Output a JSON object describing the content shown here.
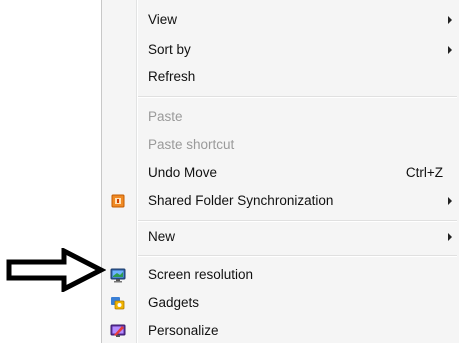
{
  "context_menu": {
    "items": [
      {
        "label": "View",
        "has_submenu": true,
        "disabled": false
      },
      {
        "label": "Sort by",
        "has_submenu": true,
        "disabled": false
      },
      {
        "label": "Refresh",
        "has_submenu": false,
        "disabled": false
      },
      {
        "label": "Paste",
        "has_submenu": false,
        "disabled": true
      },
      {
        "label": "Paste shortcut",
        "has_submenu": false,
        "disabled": true
      },
      {
        "label": "Undo Move",
        "shortcut": "Ctrl+Z",
        "has_submenu": false,
        "disabled": false
      },
      {
        "label": "Shared Folder Synchronization",
        "icon": "sync-folder-icon",
        "has_submenu": true,
        "disabled": false
      },
      {
        "label": "New",
        "has_submenu": true,
        "disabled": false
      },
      {
        "label": "Screen resolution",
        "icon": "monitor-icon",
        "has_submenu": false,
        "disabled": false
      },
      {
        "label": "Gadgets",
        "icon": "gadgets-icon",
        "has_submenu": false,
        "disabled": false
      },
      {
        "label": "Personalize",
        "icon": "personalize-icon",
        "has_submenu": false,
        "disabled": false
      }
    ]
  },
  "annotation": {
    "icon": "pointing-arrow-icon",
    "points_to": "Screen resolution"
  },
  "colors": {
    "menu_background": "#f5f5f5",
    "disabled_text": "#9a9a9a",
    "text": "#111111"
  }
}
